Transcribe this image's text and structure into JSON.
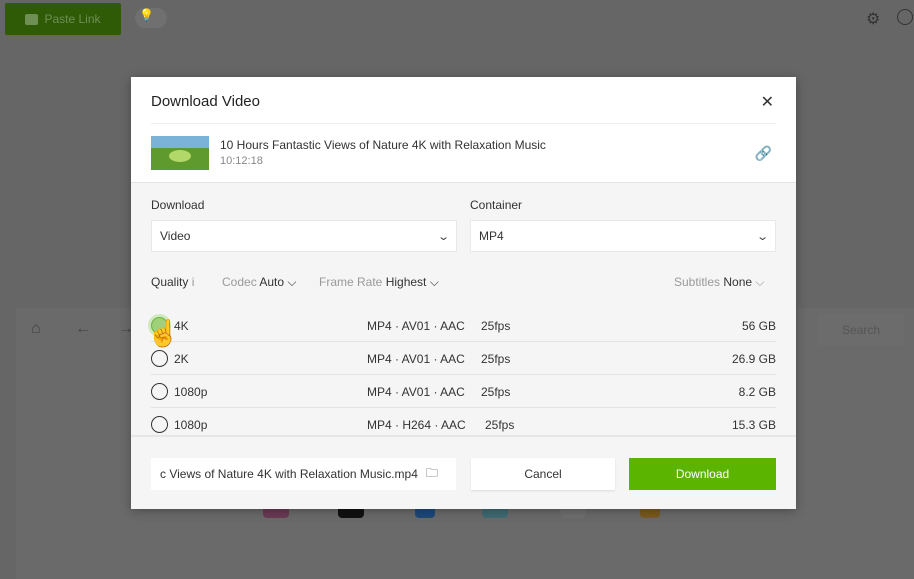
{
  "app": {
    "paste_link": "Paste Link",
    "search": "Search"
  },
  "dialog": {
    "title": "Download Video",
    "video": {
      "title": "10 Hours Fantastic Views of Nature 4K with Relaxation Music",
      "duration": "10:12:18"
    },
    "download_label": "Download",
    "download_value": "Video",
    "container_label": "Container",
    "container_value": "MP4",
    "quality_label": "Quality",
    "quality_info": "i",
    "codec_label": "Codec",
    "codec_value": "Auto",
    "framerate_label": "Frame Rate",
    "framerate_value": "Highest",
    "subtitles_label": "Subtitles",
    "subtitles_value": "None",
    "rows": [
      {
        "quality": "4K",
        "format": "MP4 · AV01 · AAC",
        "fps": "25fps",
        "size": "56 GB",
        "selected": true
      },
      {
        "quality": "2K",
        "format": "MP4 · AV01 · AAC",
        "fps": "25fps",
        "size": "26.9 GB",
        "selected": false
      },
      {
        "quality": "1080p",
        "format": "MP4 · AV01 · AAC",
        "fps": "25fps",
        "size": "8.2 GB",
        "selected": false
      },
      {
        "quality": "1080p",
        "format": "MP4 · H264 · AAC",
        "fps": "25fps",
        "size": "15.3 GB",
        "selected": false
      }
    ],
    "filename": "c Views of Nature 4K with Relaxation Music.mp4",
    "cancel": "Cancel",
    "download_button": "Download"
  },
  "colors": {
    "accent": "#5ab400",
    "overlay": "#666666"
  }
}
